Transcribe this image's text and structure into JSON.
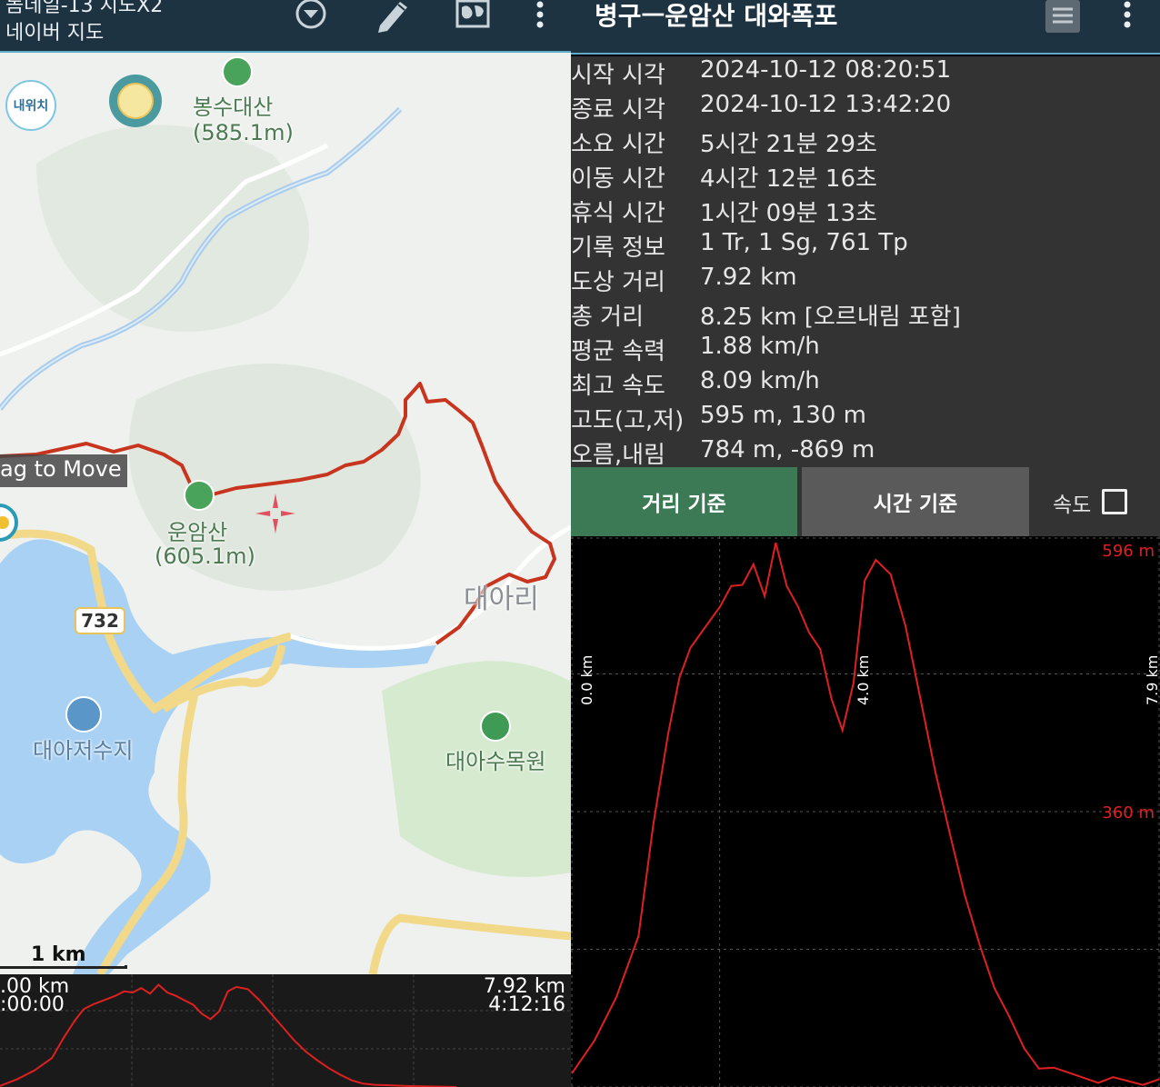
{
  "left_toolbar": {
    "title_line1": "돔데일-13 지도X2",
    "title_line2": "네이버 지도",
    "icons": [
      "layers-dropdown-icon",
      "pencil-icon",
      "world-map-icon",
      "overflow-menu-icon"
    ]
  },
  "map": {
    "my_location_label": "내위치",
    "labels": {
      "bongsu": "봉수대산",
      "bongsu_ele": "(585.1m)",
      "unam": "운암산",
      "unam_ele": "(605.1m)",
      "daeari": "대아리",
      "road": "732",
      "reservoir": "대아저수지",
      "arboretum": "대아수목원"
    },
    "drag_tip": "ag to Move",
    "scale": "1 km"
  },
  "mini_profile": {
    "start_dist": ".00 km",
    "start_time": ":00:00",
    "end_dist": "7.92 km",
    "end_time": "4:12:16"
  },
  "right_toolbar": {
    "title": "병구ㅡ운암산  대와폭포",
    "icons": [
      "list-icon",
      "overflow-menu-icon"
    ]
  },
  "stats": [
    {
      "key": "시작 시각",
      "value": "2024-10-12 08:20:51"
    },
    {
      "key": "종료 시각",
      "value": "2024-10-12 13:42:20"
    },
    {
      "key": "소요 시간",
      "value": "5시간 21분 29초"
    },
    {
      "key": "이동 시간",
      "value": "4시간 12분 16초"
    },
    {
      "key": "휴식 시간",
      "value": "1시간 09분 13초"
    },
    {
      "key": "기록 정보",
      "value": "1 Tr, 1 Sg, 761 Tp"
    },
    {
      "key": "도상 거리",
      "value": "7.92 km"
    },
    {
      "key": "총 거리",
      "value": "8.25 km [오르내림 포함]"
    },
    {
      "key": "평균 속력",
      "value": "1.88 km/h"
    },
    {
      "key": "최고 속도",
      "value": "8.09 km/h"
    },
    {
      "key": "고도(고,저)",
      "value": "595 m, 130 m"
    },
    {
      "key": "오름,내림",
      "value": "784 m, -869 m"
    }
  ],
  "tabs": {
    "distance": "거리 기준",
    "time": "시간 기준",
    "speed_label": "속도",
    "speed_checked": false
  },
  "chart_data": {
    "type": "line",
    "x_unit": "km",
    "y_unit": "m",
    "xlim": [
      0,
      7.92
    ],
    "ylim": [
      130,
      596
    ],
    "x_tick_labels": [
      "0.0 km",
      "4.0 km",
      "7.9 km"
    ],
    "y_tick_labels": [
      "596 m",
      "360 m"
    ],
    "line_color": "#e02020",
    "grid": true,
    "series": [
      {
        "x": [
          0.0,
          0.3,
          0.6,
          0.9,
          1.1,
          1.3,
          1.45,
          1.6,
          1.8,
          2.0,
          2.15,
          2.3,
          2.45,
          2.6,
          2.75,
          2.9,
          3.05,
          3.2,
          3.35,
          3.5,
          3.65,
          3.8,
          3.95,
          4.1,
          4.3,
          4.5,
          4.7,
          4.9,
          5.1,
          5.3,
          5.5,
          5.7,
          5.9,
          6.1,
          6.3,
          6.5,
          6.7,
          6.9,
          7.1,
          7.3,
          7.5,
          7.7,
          7.92
        ],
        "y": [
          135,
          165,
          205,
          260,
          350,
          430,
          480,
          500,
          520,
          540,
          560,
          555,
          575,
          550,
          590,
          555,
          540,
          520,
          500,
          460,
          435,
          470,
          560,
          580,
          570,
          520,
          460,
          400,
          340,
          290,
          250,
          215,
          185,
          160,
          145,
          140,
          138,
          136,
          134,
          133,
          132,
          131,
          130
        ]
      }
    ]
  },
  "colors": {
    "toolbar_bg": "#1e3342",
    "track_red": "#c8351e",
    "tab_active": "#3c7a55",
    "tab_inactive": "#5a5a5a",
    "stats_bg": "#333333"
  }
}
